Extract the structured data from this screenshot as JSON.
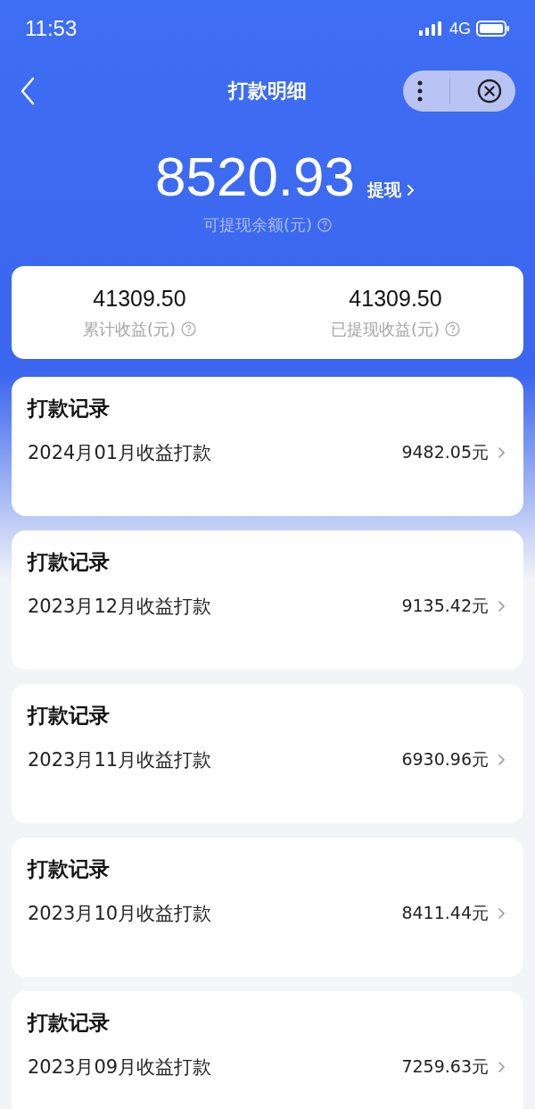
{
  "status_bar": {
    "time": "11:53",
    "network": "4G"
  },
  "nav": {
    "title": "打款明细"
  },
  "balance": {
    "amount": "8520.93",
    "withdraw": "提现",
    "label": "可提现余额(元)"
  },
  "stats": [
    {
      "value": "41309.50",
      "label": "累计收益(元)"
    },
    {
      "value": "41309.50",
      "label": "已提现收益(元)"
    }
  ],
  "records": [
    {
      "title": "打款记录",
      "name": "2024月01月收益打款",
      "amount": "9482.05元"
    },
    {
      "title": "打款记录",
      "name": "2023月12月收益打款",
      "amount": "9135.42元"
    },
    {
      "title": "打款记录",
      "name": "2023月11月收益打款",
      "amount": "6930.96元"
    },
    {
      "title": "打款记录",
      "name": "2023月10月收益打款",
      "amount": "8411.44元"
    },
    {
      "title": "打款记录",
      "name": "2023月09月收益打款",
      "amount": "7259.63元"
    }
  ]
}
